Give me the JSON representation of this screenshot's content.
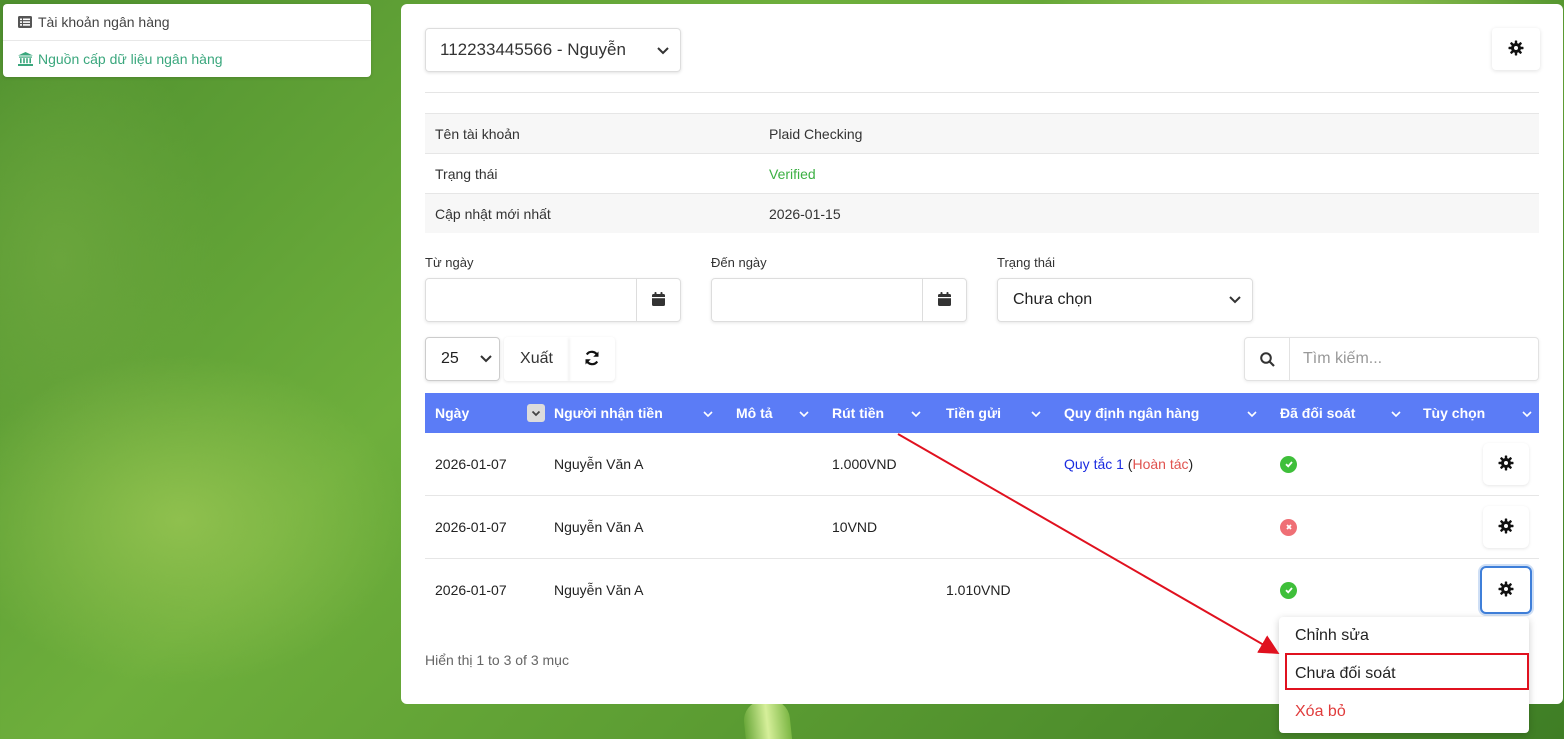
{
  "sidebar": {
    "items": [
      {
        "label": "Tài khoản ngân hàng",
        "icon": "list-icon"
      },
      {
        "label": "Nguồn cấp dữ liệu ngân hàng",
        "icon": "bank-icon"
      }
    ]
  },
  "header": {
    "account_select": "112233445566 - Nguyễn"
  },
  "info": {
    "rows": [
      {
        "key": "Tên tài khoản",
        "value": "Plaid Checking"
      },
      {
        "key": "Trạng thái",
        "value": "Verified"
      },
      {
        "key": "Cập nhật mới nhất",
        "value": "2026-01-15"
      }
    ]
  },
  "filters": {
    "from_label": "Từ ngày",
    "to_label": "Đến ngày",
    "status_label": "Trạng thái",
    "status_value": "Chưa chọn"
  },
  "toolbar": {
    "page_size": "25",
    "export_label": "Xuất",
    "search_placeholder": "Tìm kiếm..."
  },
  "table": {
    "columns": [
      "Ngày",
      "Người nhận tiền",
      "Mô tả",
      "Rút tiền",
      "Tiền gửi",
      "Quy định ngân hàng",
      "Đã đối soát",
      "Tùy chọn"
    ],
    "rows": [
      {
        "date": "2026-01-07",
        "payee": "Nguyễn Văn A",
        "desc": "",
        "withdraw": "1.000VND",
        "deposit": "",
        "rule": "Quy tắc 1",
        "rule_open": " (",
        "rule_undo": "Hoàn tác",
        "rule_close": ")",
        "reconciled": true
      },
      {
        "date": "2026-01-07",
        "payee": "Nguyễn Văn A",
        "desc": "",
        "withdraw": "10VND",
        "deposit": "",
        "rule": "",
        "rule_open": "",
        "rule_undo": "",
        "rule_close": "",
        "reconciled": false
      },
      {
        "date": "2026-01-07",
        "payee": "Nguyễn Văn A",
        "desc": "",
        "withdraw": "",
        "deposit": "1.010VND",
        "rule": "",
        "rule_open": "",
        "rule_undo": "",
        "rule_close": "",
        "reconciled": true
      }
    ]
  },
  "footer": {
    "info": "Hiển thị 1 to 3 of 3 mục"
  },
  "menu": {
    "items": [
      "Chỉnh sửa",
      "Chưa đối soát",
      "Xóa bỏ"
    ]
  },
  "colors": {
    "header_bg": "#5b7cf6",
    "success": "#3fbf3a",
    "danger": "#ef6f75",
    "annotation": "#e0111f"
  }
}
